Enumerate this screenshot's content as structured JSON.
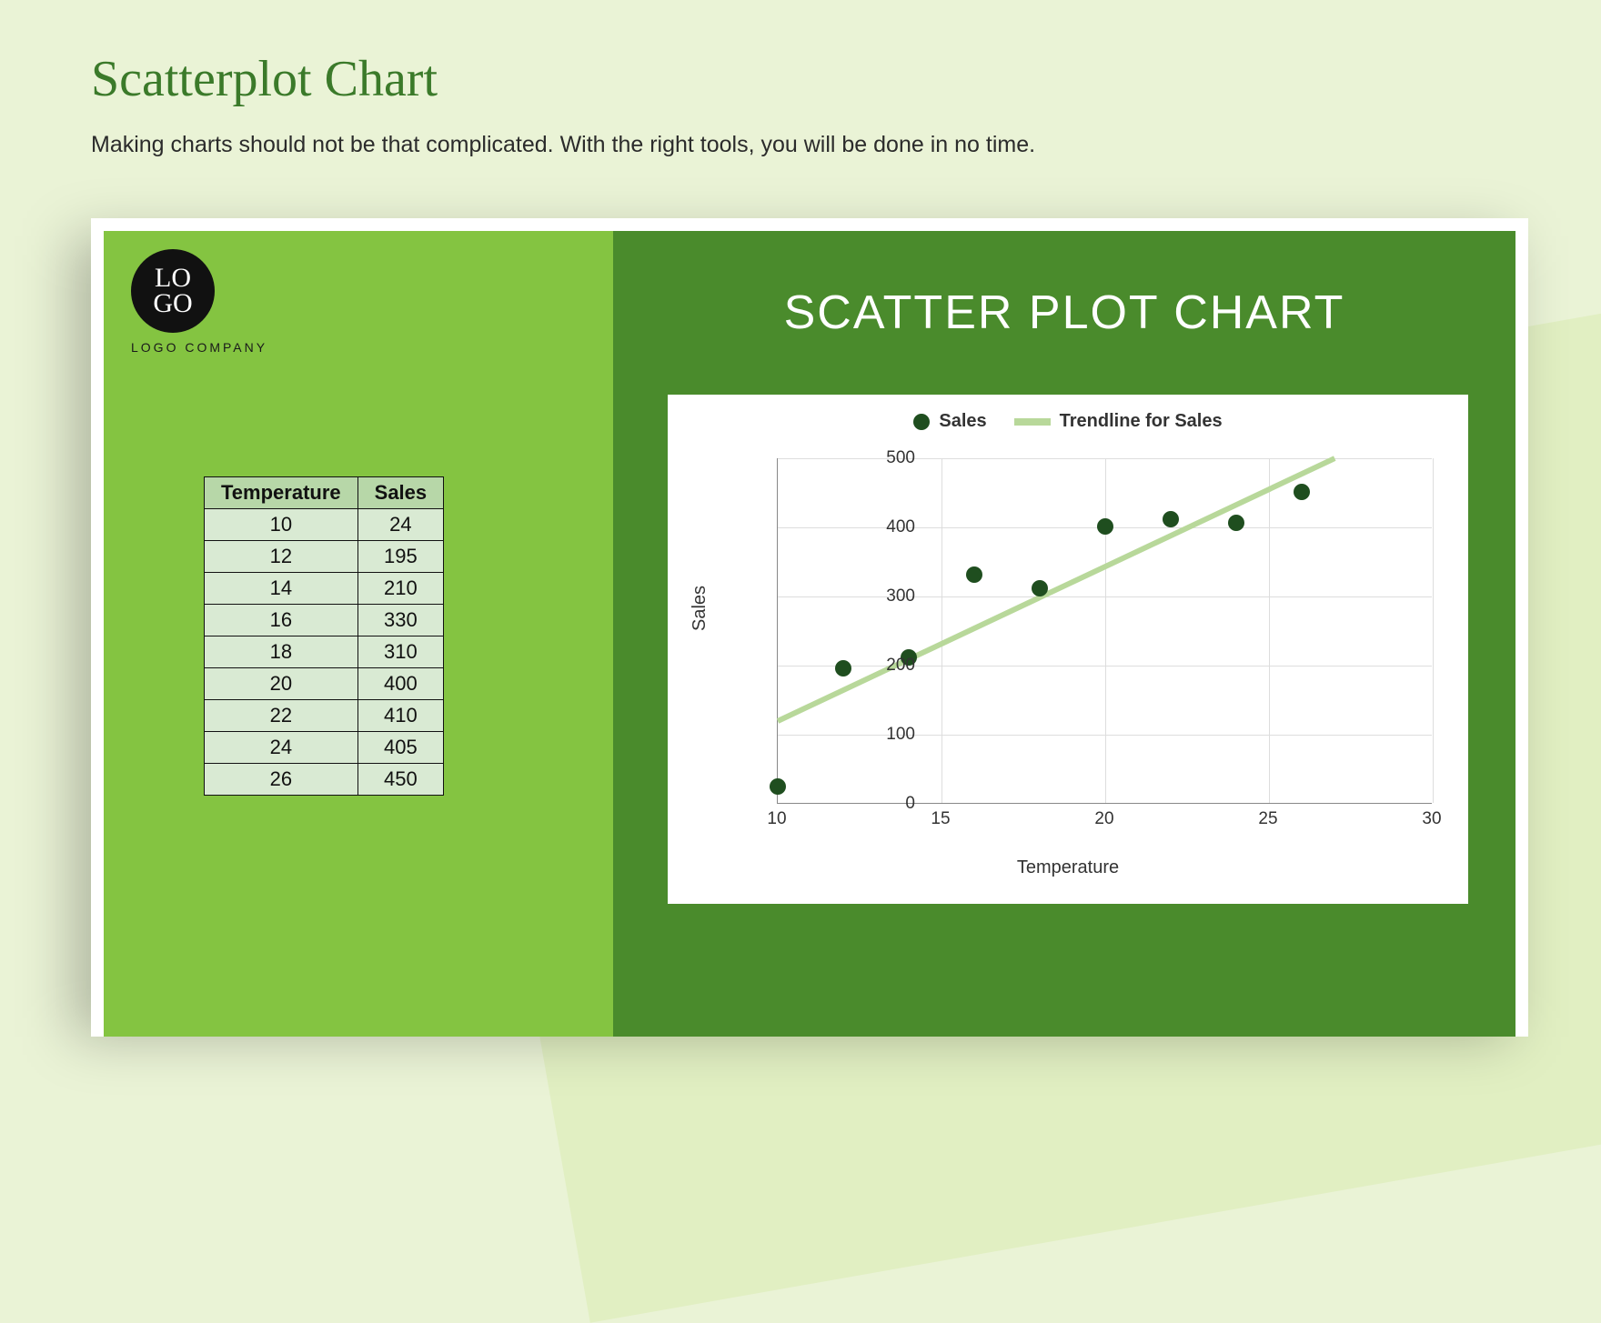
{
  "page": {
    "title": "Scatterplot Chart",
    "subtitle": "Making charts should not be that complicated. With the right tools, you will be done in no time."
  },
  "logo": {
    "glyph": "LO\nGO",
    "company": "LOGO COMPANY"
  },
  "table": {
    "headers": [
      "Temperature",
      "Sales"
    ],
    "rows": [
      [
        10,
        24
      ],
      [
        12,
        195
      ],
      [
        14,
        210
      ],
      [
        16,
        330
      ],
      [
        18,
        310
      ],
      [
        20,
        400
      ],
      [
        22,
        410
      ],
      [
        24,
        405
      ],
      [
        26,
        450
      ]
    ]
  },
  "chart": {
    "panel_title": "SCATTER PLOT CHART",
    "legend_series": "Sales",
    "legend_trend": "Trendline for Sales",
    "xlabel": "Temperature",
    "ylabel": "Sales",
    "xticks": [
      10,
      15,
      20,
      25,
      30
    ],
    "yticks": [
      0,
      100,
      200,
      300,
      400,
      500
    ],
    "xlim": [
      10,
      30
    ],
    "ylim": [
      0,
      500
    ]
  },
  "chart_data": {
    "type": "scatter",
    "title": "SCATTER PLOT CHART",
    "xlabel": "Temperature",
    "ylabel": "Sales",
    "x": [
      10,
      12,
      14,
      16,
      18,
      20,
      22,
      24,
      26
    ],
    "y": [
      24,
      195,
      210,
      330,
      310,
      400,
      410,
      405,
      450
    ],
    "xlim": [
      10,
      30
    ],
    "ylim": [
      0,
      500
    ],
    "series": [
      {
        "name": "Sales",
        "x": [
          10,
          12,
          14,
          16,
          18,
          20,
          22,
          24,
          26
        ],
        "y": [
          24,
          195,
          210,
          330,
          310,
          400,
          410,
          405,
          450
        ]
      }
    ],
    "trendline": {
      "name": "Trendline for Sales",
      "x": [
        10,
        27
      ],
      "y": [
        120,
        500
      ]
    }
  }
}
